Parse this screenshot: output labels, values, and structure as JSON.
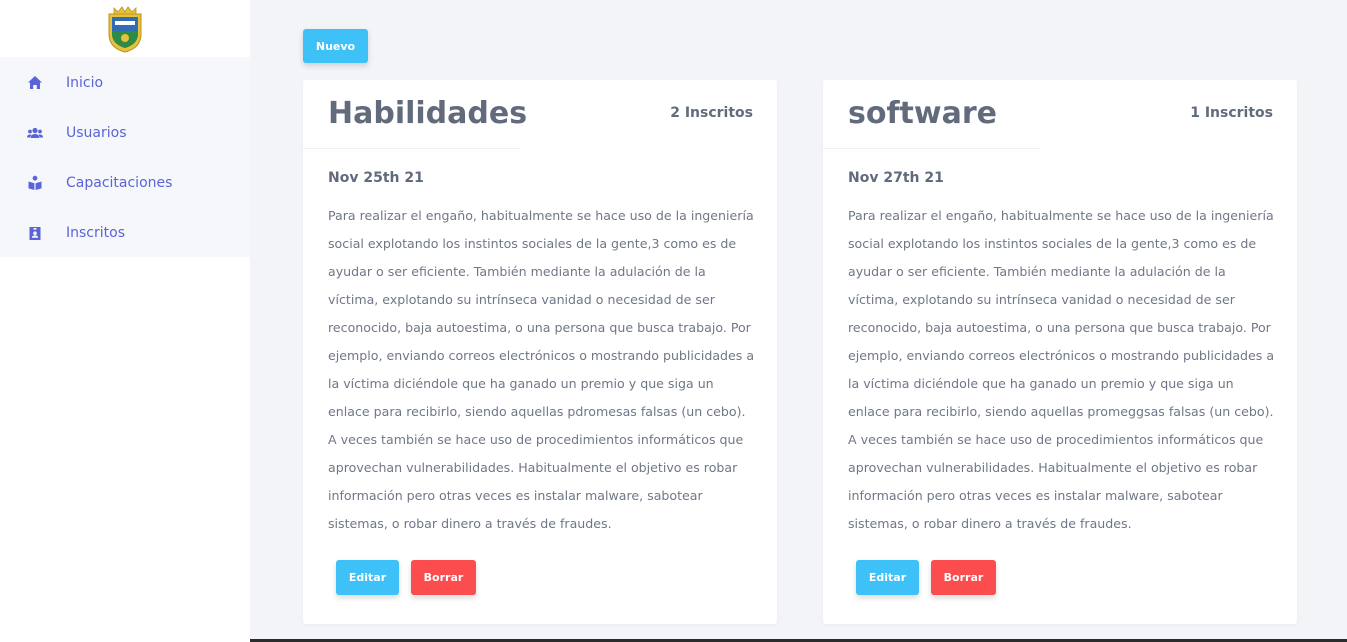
{
  "sidebar": {
    "items": [
      {
        "label": "Inicio",
        "icon": "home-icon"
      },
      {
        "label": "Usuarios",
        "icon": "users-icon"
      },
      {
        "label": "Capacitaciones",
        "icon": "book-reader-icon"
      },
      {
        "label": "Inscritos",
        "icon": "id-badge-icon"
      }
    ]
  },
  "toolbar": {
    "new_label": "Nuevo"
  },
  "cards": [
    {
      "title": "Habilidades",
      "count": "2 Inscritos",
      "date": "Nov 25th 21",
      "text": "Para realizar el engaño, habitualmente se hace uso de la ingeniería social explotando los instintos sociales de la gente,3 como es de ayudar o ser eficiente. También mediante la adulación de la víctima, explotando su intrínseca vanidad o necesidad de ser reconocido, baja autoestima, o una persona que busca trabajo. Por ejemplo, enviando correos electrónicos o mostrando publicidades a la víctima diciéndole que ha ganado un premio y que siga un enlace para recibirlo, siendo aquellas pdromesas falsas (un cebo). A veces también se hace uso de procedimientos informáticos que aprovechan vulnerabilidades. Habitualmente el objetivo es robar información pero otras veces es instalar malware, sabotear sistemas, o robar dinero a través de fraudes.",
      "edit_label": "Editar",
      "delete_label": "Borrar"
    },
    {
      "title": "software",
      "count": "1 Inscritos",
      "date": "Nov 27th 21",
      "text": "Para realizar el engaño, habitualmente se hace uso de la ingeniería social explotando los instintos sociales de la gente,3 como es de ayudar o ser eficiente. También mediante la adulación de la víctima, explotando su intrínseca vanidad o necesidad de ser reconocido, baja autoestima, o una persona que busca trabajo. Por ejemplo, enviando correos electrónicos o mostrando publicidades a la víctima diciéndole que ha ganado un premio y que siga un enlace para recibirlo, siendo aquellas promeggsas falsas (un cebo). A veces también se hace uso de procedimientos informáticos que aprovechan vulnerabilidades. Habitualmente el objetivo es robar información pero otras veces es instalar malware, sabotear sistemas, o robar dinero a través de fraudes.",
      "edit_label": "Editar",
      "delete_label": "Borrar"
    }
  ],
  "colors": {
    "accent": "#3ec1f6",
    "danger": "#fb4d4d",
    "nav_text": "#5a63d8",
    "heading": "#616b7c"
  }
}
